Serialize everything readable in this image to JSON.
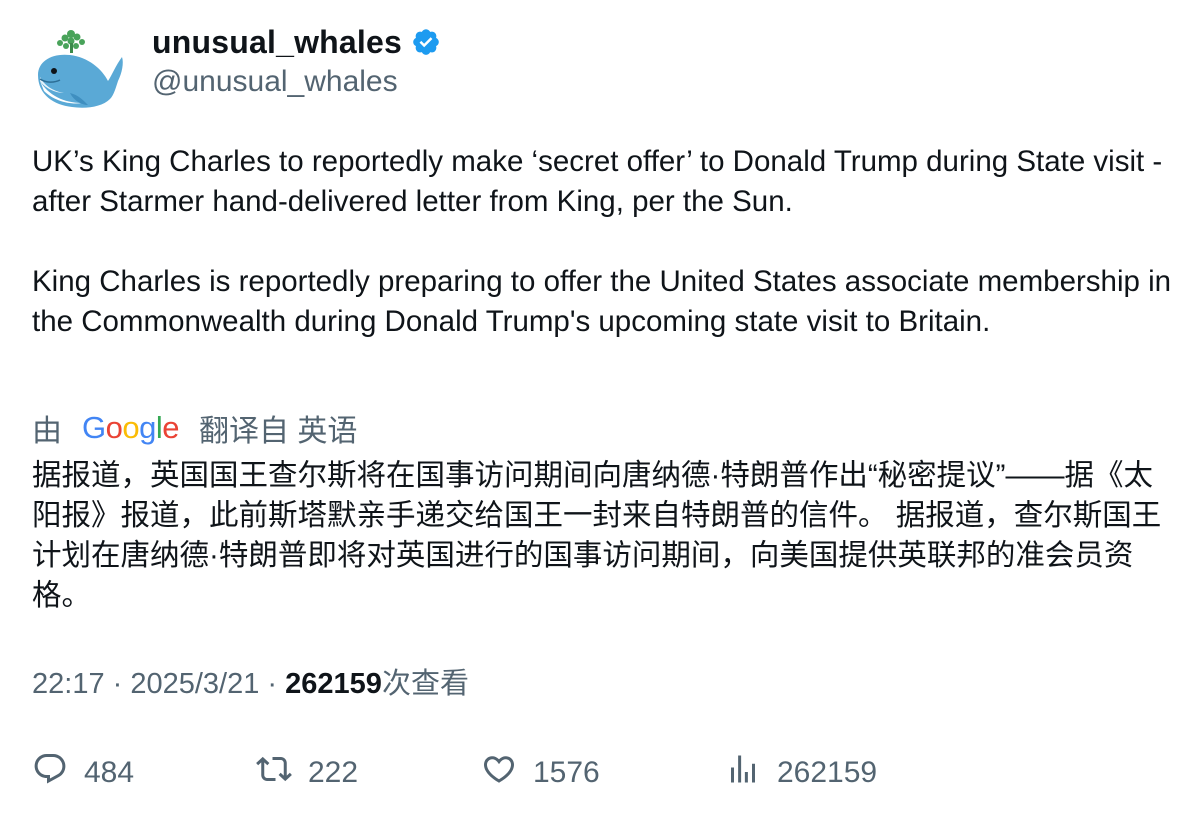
{
  "author": {
    "display_name": "unusual_whales",
    "handle": "@unusual_whales",
    "verified_color": "#1d9bf0",
    "avatar_icon": "whale-avatar-icon"
  },
  "tweet": {
    "paragraphs": [
      "UK’s King Charles to reportedly make ‘secret offer’ to Donald Trump during State visit - after Starmer hand-delivered letter from King, per the Sun.",
      "King Charles is reportedly preparing to offer the United States associate membership in the Commonwealth during Donald Trump's upcoming state visit to Britain."
    ]
  },
  "translation": {
    "prefix": "由",
    "logo_letters": [
      "G",
      "o",
      "o",
      "g",
      "l",
      "e"
    ],
    "suffix": "翻译自 英语",
    "text": "据报道，英国国王查尔斯将在国事访问期间向唐纳德·特朗普作出“秘密提议”——据《太阳报》报道，此前斯塔默亲手递交给国王一封来自特朗普的信件。 据报道，查尔斯国王计划在唐纳德·特朗普即将对英国进行的国事访问期间，向美国提供英联邦的准会员资格。"
  },
  "meta": {
    "time": "22:17",
    "sep1": " · ",
    "date": "2025/3/21",
    "sep2": " · ",
    "views": "262159",
    "views_label": "次查看"
  },
  "actions": {
    "replies": "484",
    "retweets": "222",
    "likes": "1576",
    "views": "262159"
  },
  "colors": {
    "text": "#0f1419",
    "secondary": "#536471",
    "accent": "#1d9bf0"
  }
}
